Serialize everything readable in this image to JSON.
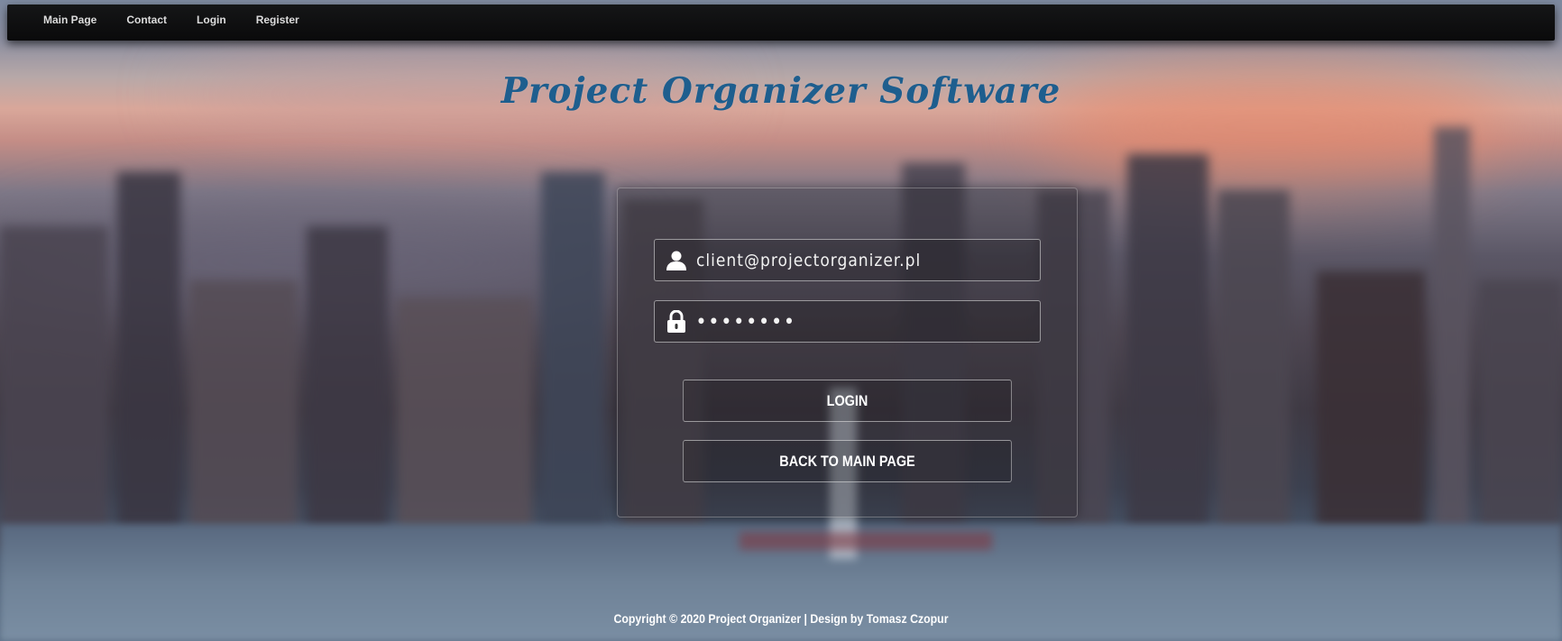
{
  "nav": {
    "items": [
      {
        "label": "Main Page"
      },
      {
        "label": "Contact"
      },
      {
        "label": "Login"
      },
      {
        "label": "Register"
      }
    ]
  },
  "header": {
    "title": "Project Organizer Software"
  },
  "login_form": {
    "email": {
      "value": "client@projectorganizer.pl",
      "icon": "user-icon"
    },
    "password": {
      "value": "••••••••",
      "icon": "lock-icon"
    },
    "login_button": "LOGIN",
    "back_button": "BACK TO MAIN PAGE"
  },
  "footer": {
    "text": "Copyright © 2020 Project Organizer | Design by Tomasz Czopur"
  },
  "colors": {
    "title": "#1e5e8e",
    "navbar": "#0a0a0b",
    "text": "#ffffff"
  }
}
